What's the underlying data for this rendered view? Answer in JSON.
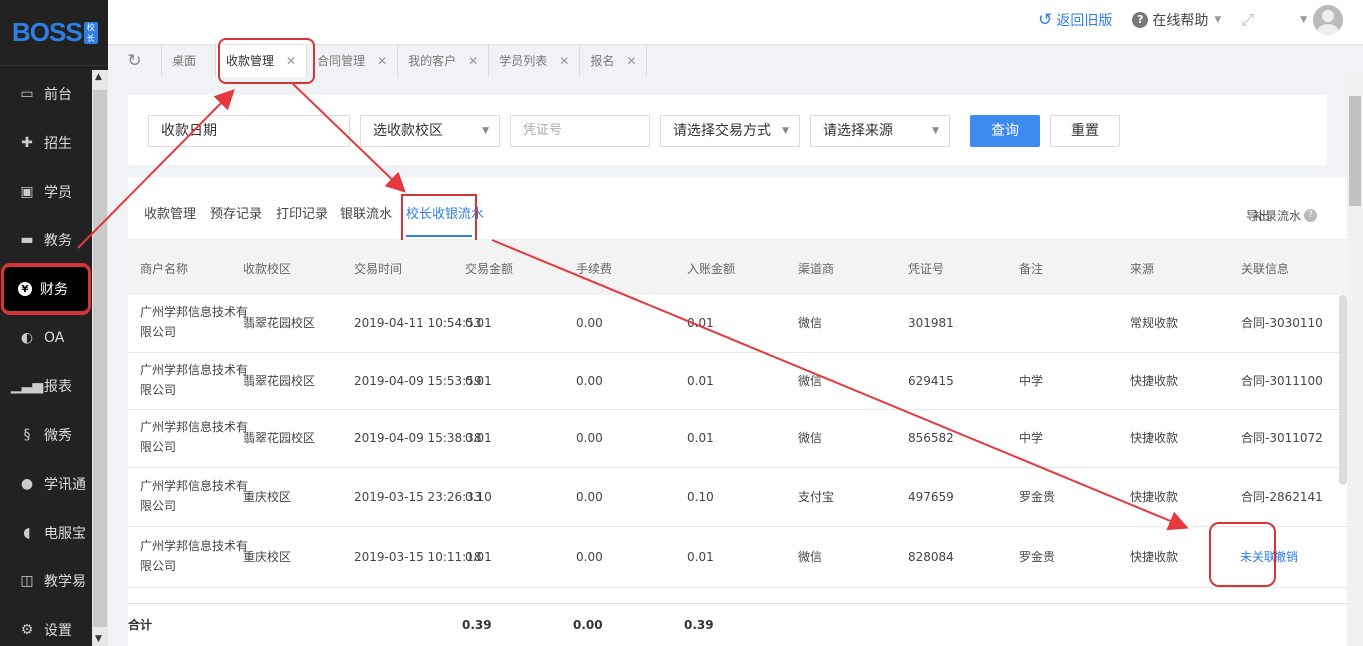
{
  "brand": {
    "logo": "BOSS",
    "badge": "校长"
  },
  "sidebar": {
    "items": [
      {
        "label": "前台",
        "icon": "calendar-icon"
      },
      {
        "label": "招生",
        "icon": "add-user-icon"
      },
      {
        "label": "学员",
        "icon": "student-card-icon"
      },
      {
        "label": "教务",
        "icon": "book-icon"
      },
      {
        "label": "财务",
        "icon": "yen-icon",
        "active": true
      },
      {
        "label": "OA",
        "icon": "toggle-icon"
      },
      {
        "label": "报表",
        "icon": "bar-chart-icon"
      },
      {
        "label": "微秀",
        "icon": "show-icon"
      },
      {
        "label": "学讯通",
        "icon": "location-icon"
      },
      {
        "label": "电服宝",
        "icon": "phone-icon"
      },
      {
        "label": "教学易",
        "icon": "teach-icon"
      },
      {
        "label": "设置",
        "icon": "gear-icon"
      }
    ]
  },
  "header": {
    "return_label": "返回旧版",
    "help_label": "在线帮助"
  },
  "tabs": [
    {
      "label": "桌面",
      "closable": false
    },
    {
      "label": "收款管理",
      "closable": true,
      "active": true
    },
    {
      "label": "合同管理",
      "closable": true
    },
    {
      "label": "我的客户",
      "closable": true
    },
    {
      "label": "学员列表",
      "closable": true
    },
    {
      "label": "报名",
      "closable": true
    }
  ],
  "filters": {
    "date_label": "收款日期",
    "campus_select": "选收款校区",
    "voucher_placeholder": "凭证号",
    "pay_method_select": "请选择交易方式",
    "source_select": "请选择来源",
    "query_label": "查询",
    "reset_label": "重置"
  },
  "subtabs": [
    "收款管理",
    "预存记录",
    "打印记录",
    "银联流水",
    "校长收银流水"
  ],
  "actions": {
    "export_label": "导出",
    "supplement_label": "补录流水"
  },
  "table": {
    "columns": [
      "商户名称",
      "收款校区",
      "交易时间",
      "交易金额",
      "手续费",
      "入账金额",
      "渠道商",
      "凭证号",
      "备注",
      "来源",
      "关联信息"
    ],
    "rows": [
      {
        "merchant_l1": "广州学邦信息技术有",
        "merchant_l2": "限公司",
        "campus": "翡翠花园校区",
        "time": "2019-04-11 10:54:53",
        "amount": "0.01",
        "fee": "0.00",
        "net": "0.01",
        "channel": "微信",
        "voucher": "301981",
        "note": "",
        "source": "常规收款",
        "link": "合同-3030110"
      },
      {
        "merchant_l1": "广州学邦信息技术有",
        "merchant_l2": "限公司",
        "campus": "翡翠花园校区",
        "time": "2019-04-09 15:53:59",
        "amount": "0.01",
        "fee": "0.00",
        "net": "0.01",
        "channel": "微信",
        "voucher": "629415",
        "note": "中学",
        "source": "快捷收款",
        "link": "合同-3011100"
      },
      {
        "merchant_l1": "广州学邦信息技术有",
        "merchant_l2": "限公司",
        "campus": "翡翠花园校区",
        "time": "2019-04-09 15:38:38",
        "amount": "0.01",
        "fee": "0.00",
        "net": "0.01",
        "channel": "微信",
        "voucher": "856582",
        "note": "中学",
        "source": "快捷收款",
        "link": "合同-3011072"
      },
      {
        "merchant_l1": "广州学邦信息技术有",
        "merchant_l2": "限公司",
        "campus": "重庆校区",
        "time": "2019-03-15 23:26:33",
        "amount": "0.10",
        "fee": "0.00",
        "net": "0.10",
        "channel": "支付宝",
        "voucher": "497659",
        "note": "罗金贵",
        "source": "快捷收款",
        "link": "合同-2862141"
      },
      {
        "merchant_l1": "广州学邦信息技术有",
        "merchant_l2": "限公司",
        "campus": "重庆校区",
        "time": "2019-03-15 10:11:18",
        "amount": "0.01",
        "fee": "0.00",
        "net": "0.01",
        "channel": "微信",
        "voucher": "828084",
        "note": "罗金贵",
        "source": "快捷收款",
        "link": "未关联",
        "link2": "撤销"
      }
    ],
    "total": {
      "label": "合计",
      "amount": "0.39",
      "fee": "0.00",
      "net": "0.39"
    }
  }
}
